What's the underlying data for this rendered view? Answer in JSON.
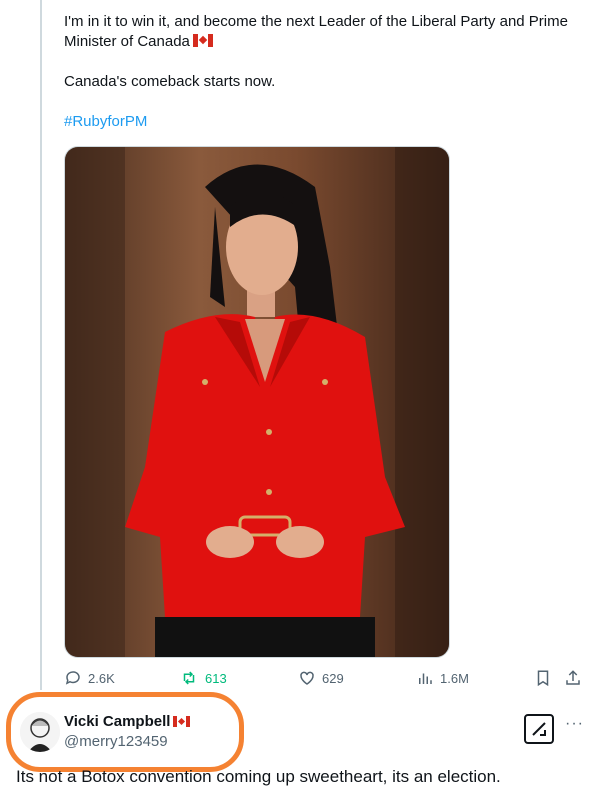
{
  "tweet": {
    "line1": "I'm in it to win it, and become the next Leader of the Liberal Party and Prime Minister of Canada",
    "line2": "Canada's comeback starts now.",
    "hashtag": "#RubyforPM",
    "flag_icon": "canada-flag-icon"
  },
  "actions": {
    "replies": "2.6K",
    "reposts": "613",
    "likes": "629",
    "views": "1.6M",
    "repost_color": "#00ba7c"
  },
  "reply": {
    "name": "Vicki Campbell",
    "handle": "@merry123459",
    "text": "Its not a Botox convention coming up sweetheart, its an election.",
    "highlight_color": "#f58232"
  }
}
